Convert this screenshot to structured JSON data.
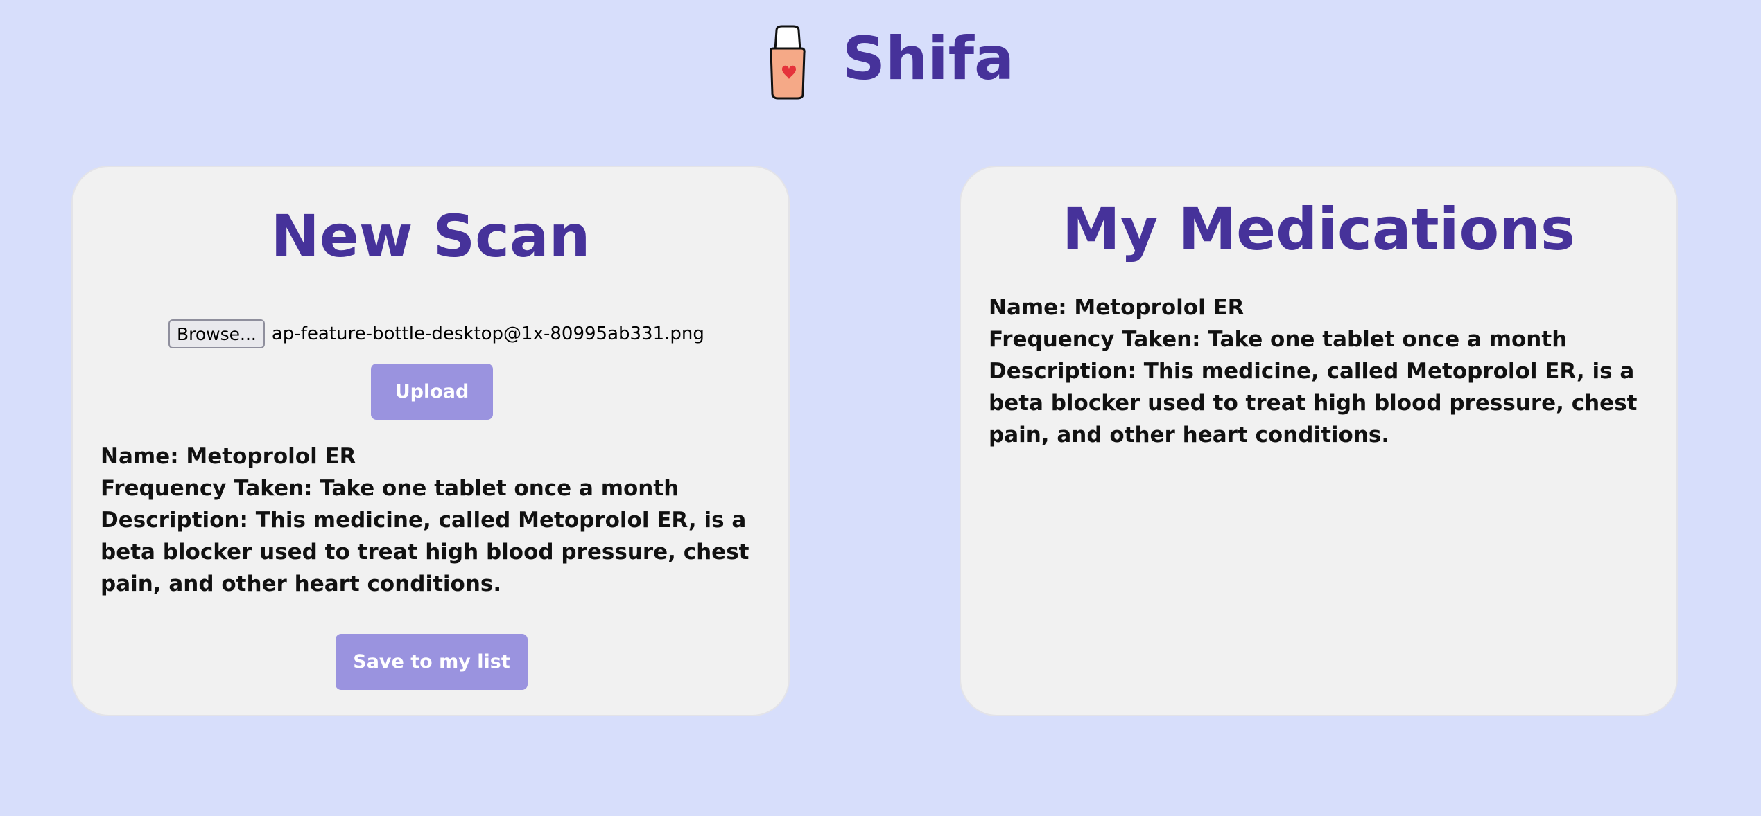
{
  "header": {
    "app_name": "Shifa",
    "logo_icon": "medicine-bottle-heart-icon"
  },
  "new_scan": {
    "title": "New Scan",
    "browse_label": "Browse...",
    "file_name": "ap-feature-bottle-desktop@1x-80995ab331.png",
    "upload_label": "Upload",
    "result": {
      "name_label": "Name:",
      "name_value": "Metoprolol ER",
      "frequency_label": "Frequency Taken:",
      "frequency_value": "Take one tablet once a month",
      "description_label": "Description:",
      "description_value": "This medicine, called Metoprolol ER, is a beta blocker used to treat high blood pressure, chest pain, and other heart conditions."
    },
    "save_label": "Save to my list"
  },
  "my_medications": {
    "title": "My Medications",
    "items": [
      {
        "name_label": "Name:",
        "name_value": "Metoprolol ER",
        "frequency_label": "Frequency Taken:",
        "frequency_value": "Take one tablet once a month",
        "description_label": "Description:",
        "description_value": "This medicine, called Metoprolol ER, is a beta blocker used to treat high blood pressure, chest pain, and other heart conditions."
      }
    ]
  },
  "colors": {
    "background": "#d7defb",
    "card": "#f1f1f1",
    "accent": "#46329a",
    "button": "#9a93df"
  }
}
